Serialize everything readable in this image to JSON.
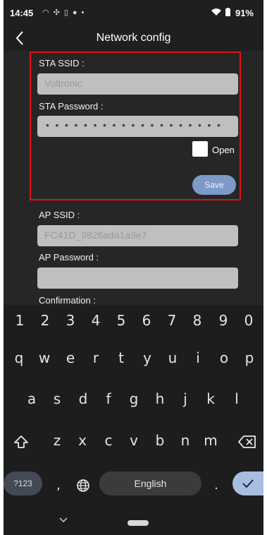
{
  "status_bar": {
    "time": "14:45",
    "notification_icons": [
      "wifi-call-icon",
      "fan-icon",
      "sim-icon",
      "media-icon",
      "dot-icon"
    ],
    "battery": "91%"
  },
  "app_bar": {
    "title": "Network config"
  },
  "form": {
    "sta_ssid_label": "STA SSID :",
    "sta_ssid_value": "Voltronic",
    "sta_password_label": "STA Password :",
    "sta_password_masked": "•••••••••••••••••••",
    "open_label": "Open",
    "open_checked": false,
    "save_label": "Save",
    "ap_ssid_label": "AP SSID :",
    "ap_ssid_value": "FC41D_9826ada1a9e7",
    "ap_password_label": "AP Password :",
    "ap_password_value": "",
    "confirmation_label": "Confirmation :"
  },
  "keyboard": {
    "numbers": [
      "1",
      "2",
      "3",
      "4",
      "5",
      "6",
      "7",
      "8",
      "9",
      "0"
    ],
    "row1": [
      "q",
      "w",
      "e",
      "r",
      "t",
      "y",
      "u",
      "i",
      "o",
      "p"
    ],
    "row2": [
      "a",
      "s",
      "d",
      "f",
      "g",
      "h",
      "j",
      "k",
      "l"
    ],
    "row3": [
      "z",
      "x",
      "c",
      "v",
      "b",
      "n",
      "m"
    ],
    "symbols_label": "?123",
    "comma": ",",
    "space_label": "English",
    "period": "."
  },
  "colors": {
    "highlight_border": "#e0101a",
    "save_button": "#7e9ac7",
    "enter_key": "#a9bde1"
  }
}
